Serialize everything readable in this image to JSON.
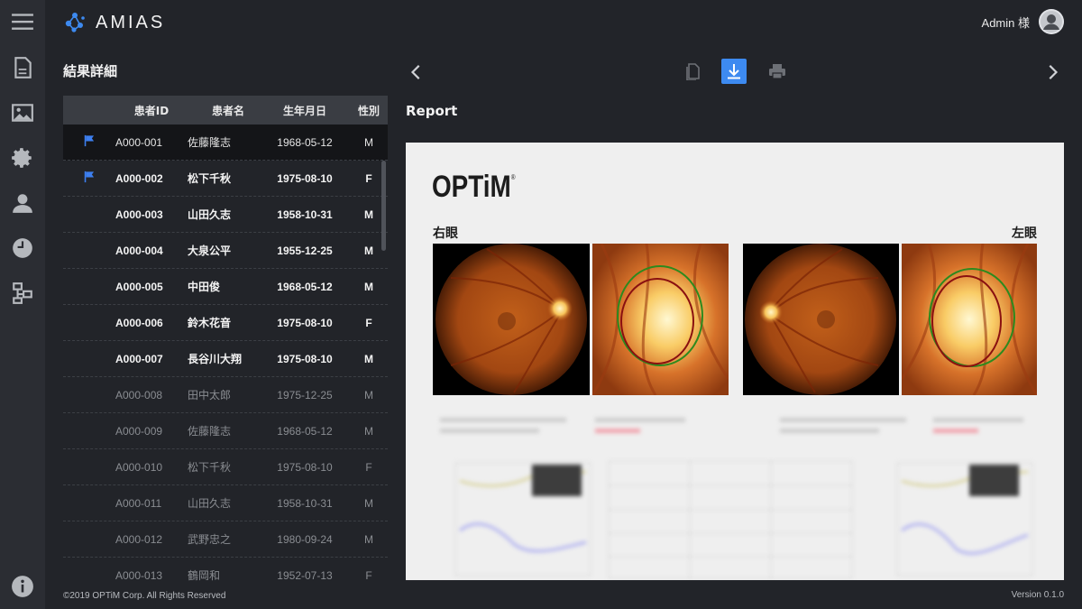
{
  "app": {
    "brand": "AMIAS",
    "user_label": "Admin 様",
    "copyright": "©2019 OPTiM Corp. All Rights Reserved",
    "version": "Version 0.1.0",
    "accent": "#3d8af0"
  },
  "rail": [
    {
      "icon": "menu-icon"
    },
    {
      "icon": "document-icon"
    },
    {
      "icon": "image-icon"
    },
    {
      "icon": "gear-icon"
    },
    {
      "icon": "user-icon"
    },
    {
      "icon": "clock-icon"
    },
    {
      "icon": "network-icon"
    },
    {
      "icon": "info-icon"
    }
  ],
  "panel": {
    "title": "結果詳細",
    "columns": {
      "id": "患者ID",
      "name": "患者名",
      "birth": "生年月日",
      "sex": "性別"
    },
    "rows": [
      {
        "id": "A000-001",
        "name": "佐藤隆志",
        "birth": "1968-05-12",
        "sex": "M",
        "flag": true,
        "state": "selected"
      },
      {
        "id": "A000-002",
        "name": "松下千秋",
        "birth": "1975-08-10",
        "sex": "F",
        "flag": true,
        "state": "bold"
      },
      {
        "id": "A000-003",
        "name": "山田久志",
        "birth": "1958-10-31",
        "sex": "M",
        "flag": false,
        "state": "bold"
      },
      {
        "id": "A000-004",
        "name": "大泉公平",
        "birth": "1955-12-25",
        "sex": "M",
        "flag": false,
        "state": "bold"
      },
      {
        "id": "A000-005",
        "name": "中田俊",
        "birth": "1968-05-12",
        "sex": "M",
        "flag": false,
        "state": "bold"
      },
      {
        "id": "A000-006",
        "name": "鈴木花音",
        "birth": "1975-08-10",
        "sex": "F",
        "flag": false,
        "state": "bold"
      },
      {
        "id": "A000-007",
        "name": "長谷川大翔",
        "birth": "1975-08-10",
        "sex": "M",
        "flag": false,
        "state": "bold"
      },
      {
        "id": "A000-008",
        "name": "田中太郎",
        "birth": "1975-12-25",
        "sex": "M",
        "flag": false,
        "state": "dim"
      },
      {
        "id": "A000-009",
        "name": "佐藤隆志",
        "birth": "1968-05-12",
        "sex": "M",
        "flag": false,
        "state": "dim"
      },
      {
        "id": "A000-010",
        "name": "松下千秋",
        "birth": "1975-08-10",
        "sex": "F",
        "flag": false,
        "state": "dim"
      },
      {
        "id": "A000-011",
        "name": "山田久志",
        "birth": "1958-10-31",
        "sex": "M",
        "flag": false,
        "state": "dim"
      },
      {
        "id": "A000-012",
        "name": "武野忠之",
        "birth": "1980-09-24",
        "sex": "M",
        "flag": false,
        "state": "dim"
      },
      {
        "id": "A000-013",
        "name": "鶴岡和",
        "birth": "1952-07-13",
        "sex": "F",
        "flag": false,
        "state": "dim"
      }
    ]
  },
  "viewer": {
    "title": "Report",
    "tools": [
      {
        "icon": "copy-icon",
        "active": false
      },
      {
        "icon": "download-icon",
        "active": true
      },
      {
        "icon": "print-icon",
        "active": false
      }
    ],
    "report": {
      "logo": "OPTiM",
      "logo_mark": "®",
      "right_eye": "右眼",
      "left_eye": "左眼"
    }
  }
}
